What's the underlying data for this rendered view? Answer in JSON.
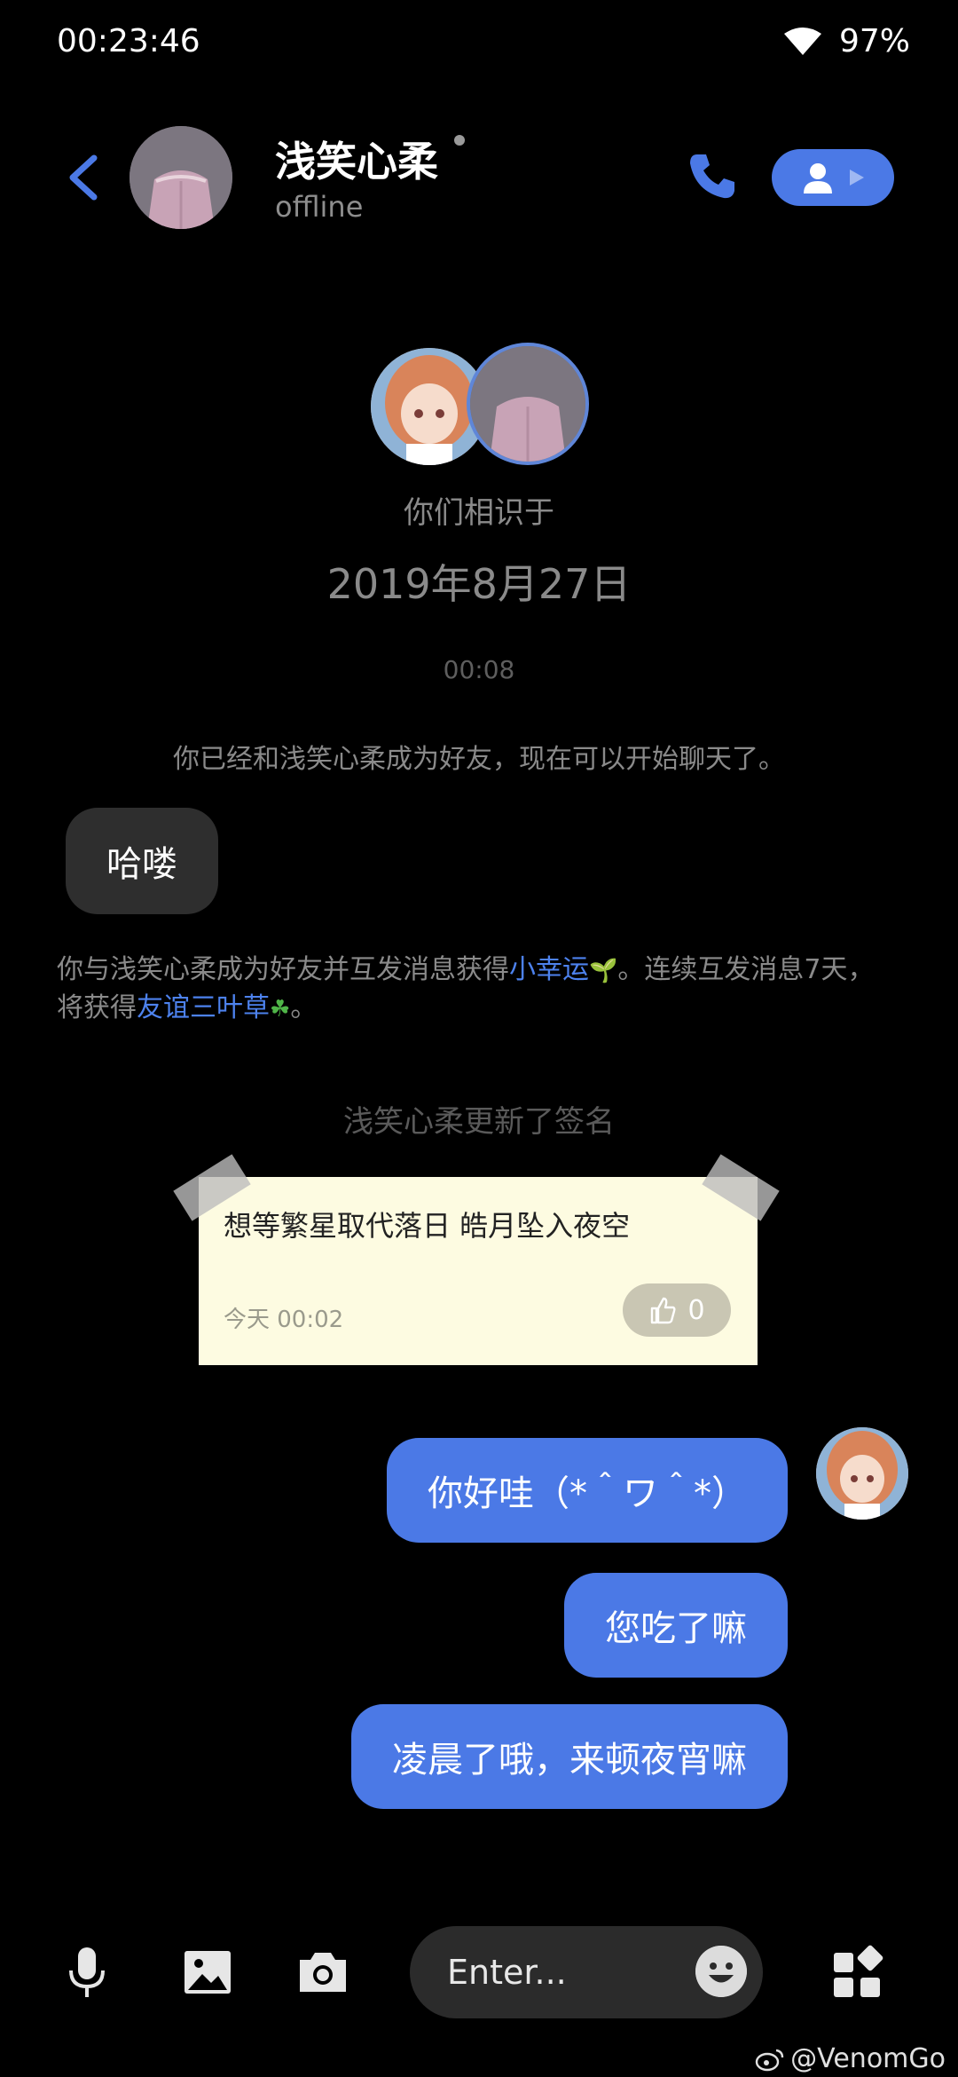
{
  "status_bar": {
    "time": "00:23:46",
    "battery": "97%",
    "wifi_icon": "wifi-icon"
  },
  "header": {
    "contact_name": "浅笑心柔",
    "presence": "offline"
  },
  "meet": {
    "label": "你们相识于",
    "date": "2019年8月27日"
  },
  "conversation": {
    "time_separator": "00:08",
    "friend_notice": "你已经和浅笑心柔成为好友，现在可以开始聊天了。",
    "incoming": [
      {
        "text": "哈喽"
      }
    ],
    "luck": {
      "part1": "你与浅笑心柔成为好友并互发消息获得",
      "link1": "小幸运",
      "part2": "。连续互发消息7天，将获得",
      "link2": "友谊三叶草",
      "part3": "。"
    },
    "signature_update": "浅笑心柔更新了签名",
    "signature_card": {
      "text": "想等繁星取代落日 皓月坠入夜空",
      "time": "今天 00:02",
      "likes": "0"
    },
    "outgoing": [
      {
        "text": "你好哇（*＾ワ＾*）"
      },
      {
        "text": "您吃了嘛"
      },
      {
        "text": "凌晨了哦，来顿夜宵嘛"
      }
    ]
  },
  "input_bar": {
    "placeholder": "Enter..."
  },
  "watermark": "@VenomGo",
  "colors": {
    "accent": "#4b79e6",
    "background": "#000000",
    "incoming_bubble": "#2e2e2e",
    "note_paper": "#fdfbe1"
  }
}
